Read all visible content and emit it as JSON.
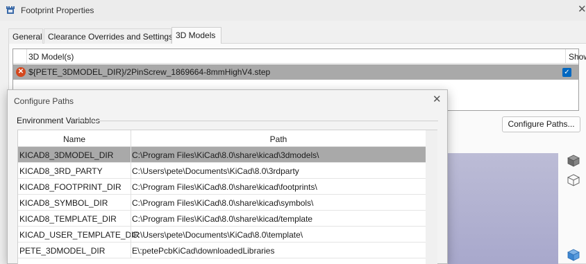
{
  "window": {
    "title": "Footprint Properties",
    "close_glyph": "✕",
    "app_icon": "kicad-footprint-icon"
  },
  "tabs": [
    {
      "label": "General",
      "active": false
    },
    {
      "label": "Clearance Overrides and Settings",
      "active": false
    },
    {
      "label": "3D Models",
      "active": true
    }
  ],
  "models_grid": {
    "columns": {
      "model": "3D Model(s)",
      "show": "Show"
    },
    "rows": [
      {
        "status_icon": "error-icon",
        "path": "${PETE_3DMODEL_DIR}/2PinScrew_1869664-8mmHighV4.step",
        "show": true
      }
    ]
  },
  "configure_paths_button": "Configure Paths...",
  "preview_toolbar": [
    "cube-solid-icon",
    "cube-wireframe-icon",
    "cube-blue-icon"
  ],
  "dialog": {
    "title": "Configure Paths",
    "close_glyph": "✕",
    "group_label": "Environment Variables",
    "columns": {
      "name": "Name",
      "path": "Path"
    },
    "rows": [
      {
        "name": "KICAD8_3DMODEL_DIR",
        "path": "C:\\Program Files\\KiCad\\8.0\\share\\kicad\\3dmodels\\",
        "selected": true
      },
      {
        "name": "KICAD8_3RD_PARTY",
        "path": "C:\\Users\\pete\\Documents\\KiCad\\8.0\\3rdparty",
        "selected": false
      },
      {
        "name": "KICAD8_FOOTPRINT_DIR",
        "path": "C:\\Program Files\\KiCad\\8.0\\share\\kicad\\footprints\\",
        "selected": false
      },
      {
        "name": "KICAD8_SYMBOL_DIR",
        "path": "C:\\Program Files\\KiCad\\8.0\\share\\kicad\\symbols\\",
        "selected": false
      },
      {
        "name": "KICAD8_TEMPLATE_DIR",
        "path": "C:\\Program Files\\KiCad\\8.0\\share\\kicad/template",
        "selected": false
      },
      {
        "name": "KICAD_USER_TEMPLATE_DIR",
        "path": "C:\\Users\\pete\\Documents\\KiCad\\8.0\\template\\",
        "selected": false
      },
      {
        "name": "PETE_3DMODEL_DIR",
        "path": "E\\:petePcbKiCad\\downloadedLibraries",
        "selected": false
      }
    ]
  }
}
